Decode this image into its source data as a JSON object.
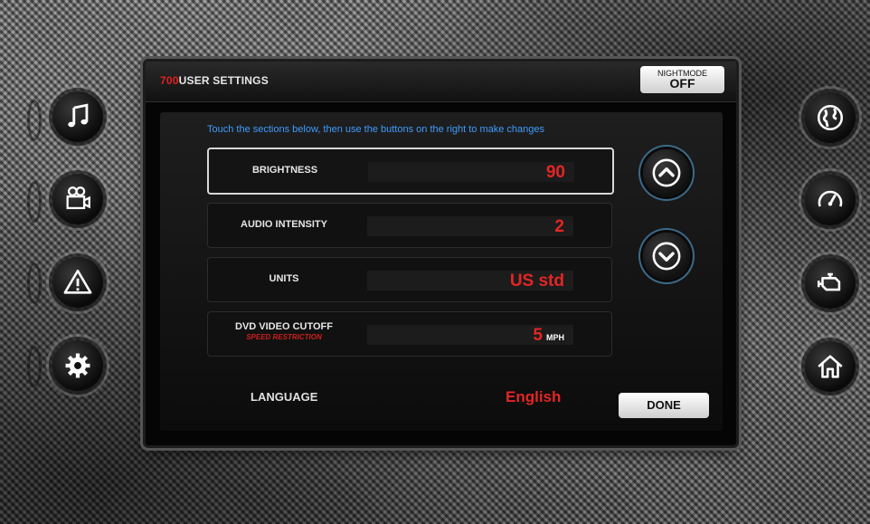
{
  "header": {
    "model_number": "700",
    "title": "USER SETTINGS",
    "nightmode_label": "NIGHTMODE",
    "nightmode_value": "OFF"
  },
  "instructions": "Touch the sections below, then use the buttons on the right to make changes",
  "settings": [
    {
      "label": "BRIGHTNESS",
      "value": "90",
      "unit": "",
      "sublabel": "",
      "selected": true
    },
    {
      "label": "AUDIO INTENSITY",
      "value": "2",
      "unit": "",
      "sublabel": ""
    },
    {
      "label": "UNITS",
      "value": "US std",
      "unit": "",
      "sublabel": ""
    },
    {
      "label": "DVD VIDEO CUTOFF",
      "value": "5",
      "unit": "MPH",
      "sublabel": "SPEED RESTRICTION"
    }
  ],
  "language": {
    "label": "LANGUAGE",
    "value": "English"
  },
  "done_label": "DONE",
  "left_nav": [
    "music-icon",
    "video-camera-icon",
    "warning-icon",
    "settings-gear-icon"
  ],
  "right_nav": [
    "globe-icon",
    "speedometer-icon",
    "engine-icon",
    "home-icon"
  ],
  "colors": {
    "accent_red": "#e42525",
    "hint_blue": "#3e9bff",
    "arrow_ring": "#3c6a88"
  }
}
